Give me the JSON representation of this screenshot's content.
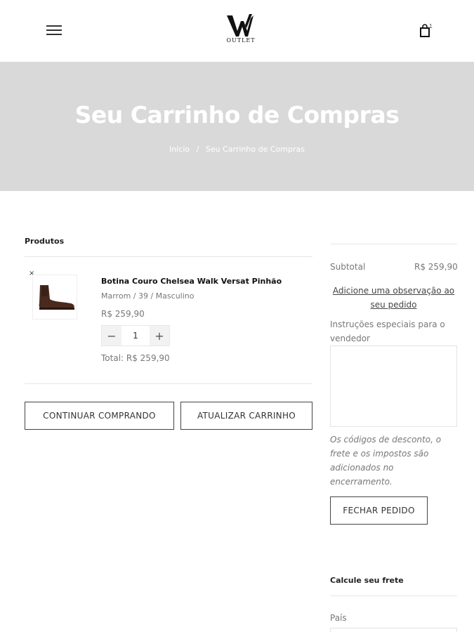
{
  "header": {
    "logo_text": "OUTLET",
    "cart_count": "1"
  },
  "hero": {
    "title": "Seu Carrinho de Compras",
    "breadcrumb_home": "Início",
    "breadcrumb_sep": "/",
    "breadcrumb_current": "Seu Carrinho de Compras"
  },
  "cart": {
    "products_heading": "Produtos",
    "item": {
      "remove": "×",
      "name": "Botina Couro Chelsea Walk Versat Pinhão",
      "variant": "Marrom / 39 / Masculino",
      "price": "R$ 259,90",
      "quantity": "1",
      "minus": "−",
      "plus": "+",
      "total": "Total: R$ 259,90"
    },
    "continue_label": "CONTINUAR COMPRANDO",
    "update_label": "ATUALIZAR CARRINHO"
  },
  "summary": {
    "subtotal_label": "Subtotal",
    "subtotal_value": "R$ 259,90",
    "note_link": "Adicione uma observação ao seu pedido",
    "instructions_label": "Instruções especiais para o vendedor",
    "tax_note": "Os códigos de desconto, o frete e os impostos são adicionados no encerramento.",
    "checkout_label": "FECHAR PEDIDO",
    "shipping_heading": "Calcule seu frete",
    "country_label": "País"
  }
}
